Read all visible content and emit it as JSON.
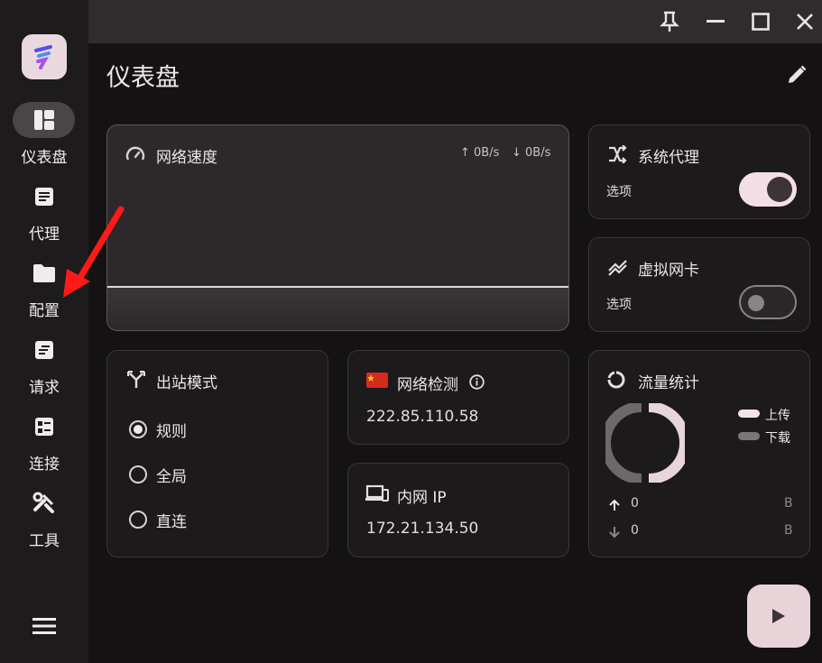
{
  "page_title": "仪表盘",
  "nav": [
    {
      "label": "仪表盘",
      "icon": "dashboard-icon",
      "active": true
    },
    {
      "label": "代理",
      "icon": "proxy-list-icon"
    },
    {
      "label": "配置",
      "icon": "folder-icon"
    },
    {
      "label": "请求",
      "icon": "request-icon"
    },
    {
      "label": "连接",
      "icon": "connection-icon"
    },
    {
      "label": "工具",
      "icon": "tools-icon"
    }
  ],
  "speed": {
    "title": "网络速度",
    "up": "↑ 0B/s",
    "down": "↓ 0B/s"
  },
  "system_proxy": {
    "title": "系统代理",
    "option": "选项",
    "enabled": true
  },
  "virtual_nic": {
    "title": "虚拟网卡",
    "option": "选项",
    "enabled": false
  },
  "outbound": {
    "title": "出站模式",
    "options": [
      "规则",
      "全局",
      "直连"
    ],
    "selected": "规则"
  },
  "network_check": {
    "title": "网络检测",
    "ip": "222.85.110.58"
  },
  "intranet": {
    "title": "内网 IP",
    "ip": "172.21.134.50"
  },
  "traffic": {
    "title": "流量统计",
    "legend_upload": "上传",
    "legend_download": "下载",
    "upload_value": "0",
    "download_value": "0",
    "upload_unit": "B",
    "download_unit": "B"
  },
  "colors": {
    "accent": "#f3dfe5",
    "card": "#1c1a1b",
    "background": "#141213"
  }
}
